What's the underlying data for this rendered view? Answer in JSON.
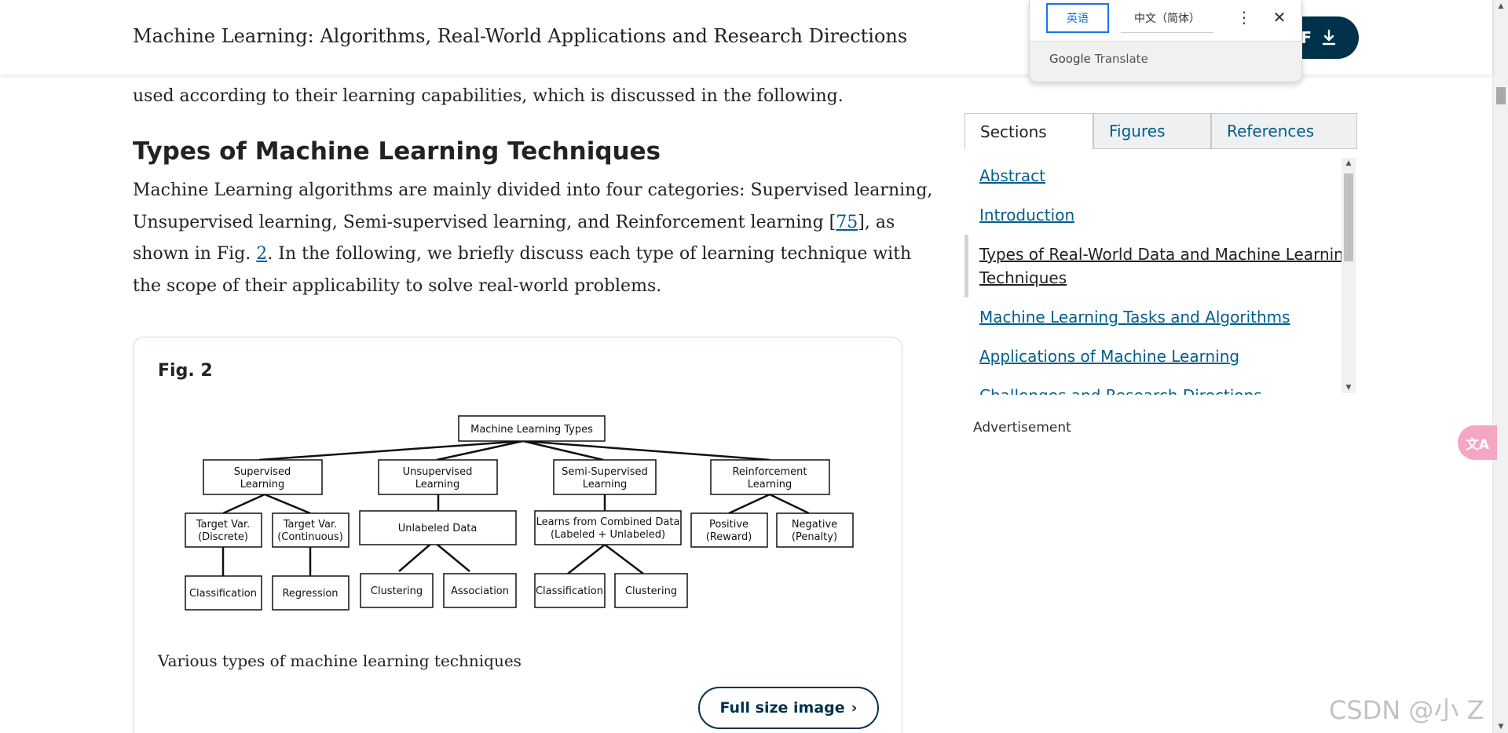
{
  "header": {
    "title": "Machine Learning: Algorithms, Real-World Applications and Research Directions",
    "pdf_label": "F"
  },
  "translate_popup": {
    "source_lang": "英语",
    "target_lang": "中文（简体）",
    "more_icon": "more-vert-icon",
    "close_icon": "close-icon",
    "brand_google": "Google",
    "brand_translate": "Translate"
  },
  "article": {
    "para_top": "used according to their learning capabilities, which is discussed in the following.",
    "section_heading": "Types of Machine Learning Techniques",
    "para": {
      "l1": "Machine Learning algorithms are mainly divided into four categories: Supervised learning,",
      "l2_a": "Unsupervised learning, Semi-supervised learning, and Reinforcement learning [",
      "l2_cite": "75",
      "l2_b": "], as",
      "l3_a": "shown in Fig. ",
      "l3_cite": "2",
      "l3_b": ". In the following, we briefly discuss each type of learning technique with",
      "l4": "the scope of their applicability to solve real-world problems."
    },
    "figure": {
      "label": "Fig. 2",
      "caption": "Various types of machine learning techniques",
      "full_size_label": "Full size image",
      "diagram": {
        "root": "Machine Learning Types",
        "supervised": [
          "Supervised",
          "Learning"
        ],
        "unsupervised": [
          "Unsupervised",
          "Learning"
        ],
        "semi": [
          "Semi-Supervised",
          "Learning"
        ],
        "reinforcement": [
          "Reinforcement",
          "Learning"
        ],
        "target_discrete": [
          "Target Var.",
          "(Discrete)"
        ],
        "target_continuous": [
          "Target Var.",
          "(Continuous)"
        ],
        "unlabeled": "Unlabeled Data",
        "combined": [
          "Learns from Combined Data",
          "(Labeled + Unlabeled)"
        ],
        "positive": [
          "Positive",
          "(Reward)"
        ],
        "negative": [
          "Negative",
          "(Penalty)"
        ],
        "classification": "Classification",
        "regression": "Regression",
        "clustering": "Clustering",
        "association": "Association",
        "semi_classification": "Classification",
        "semi_clustering": "Clustering"
      }
    }
  },
  "sidebar": {
    "tabs": [
      "Sections",
      "Figures",
      "References"
    ],
    "toc": [
      "Abstract",
      "Introduction",
      "Types of Real-World Data and Machine Learning",
      "Techniques",
      "Machine Learning Tasks and Algorithms",
      "Applications of Machine Learning",
      "Challenges and Research Directions"
    ],
    "advertisement": "Advertisement"
  },
  "floating": {
    "translate_fab": "文A",
    "watermark": "CSDN @小 Z"
  }
}
